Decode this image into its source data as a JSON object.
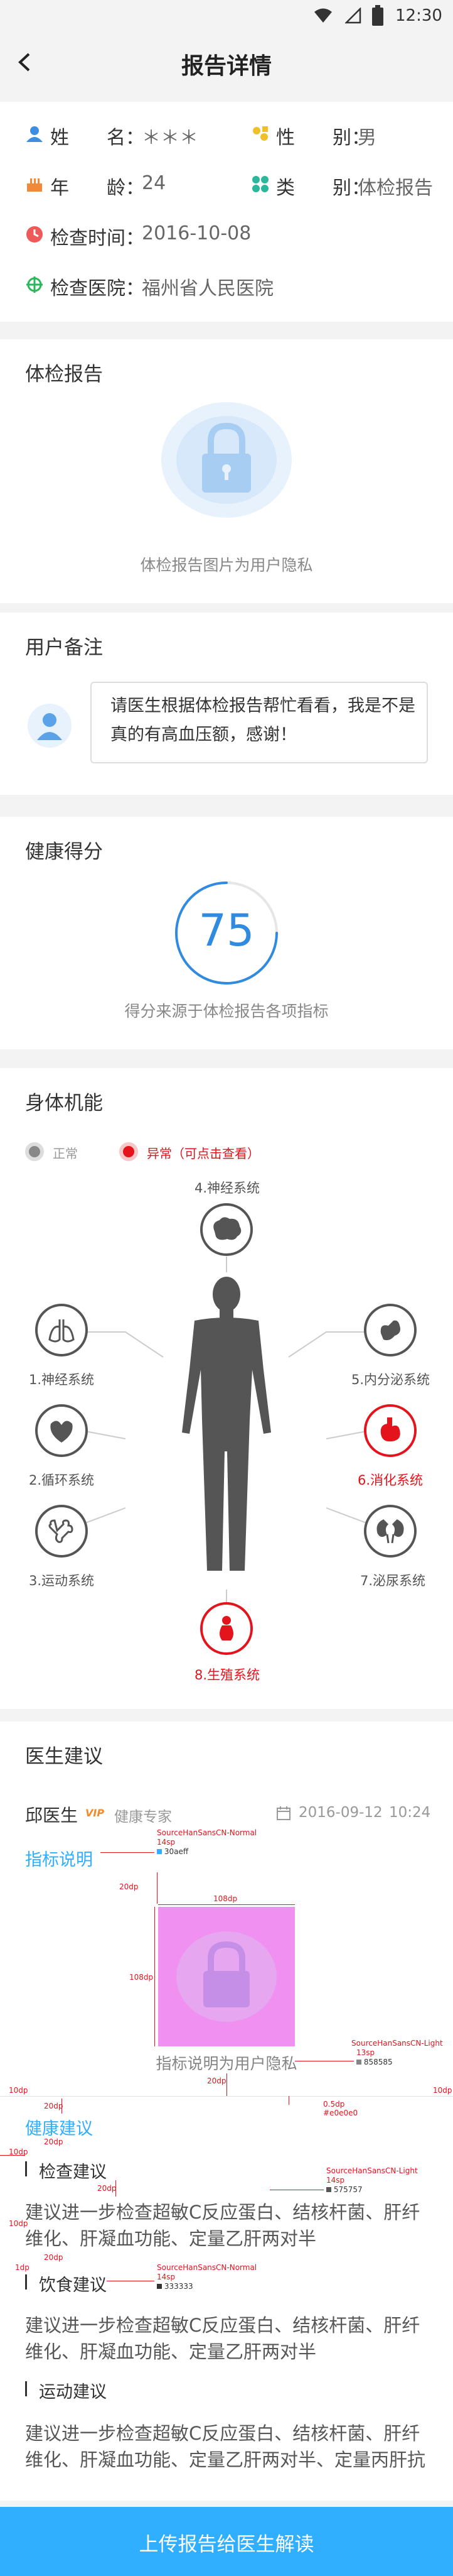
{
  "status_bar": {
    "time": "12:30"
  },
  "header": {
    "title": "报告详情"
  },
  "info": {
    "name_label": "姓　　名：",
    "name_value": "＊＊＊",
    "gender_label": "性　　别：",
    "gender_value": "男",
    "age_label": "年　　龄：",
    "age_value": "24",
    "type_label": "类　　别：",
    "type_value": "体检报告",
    "date_label": "检查时间：",
    "date_value": "2016-10-08",
    "hospital_label": "检查医院：",
    "hospital_value": "福州省人民医院"
  },
  "report": {
    "title": "体检报告",
    "privacy_text": "体检报告图片为用户隐私"
  },
  "remark": {
    "title": "用户备注",
    "text": "请医生根据体检报告帮忙看看，我是不是真的有高血压额，感谢！"
  },
  "score": {
    "title": "健康得分",
    "value": "75",
    "note": "得分来源于体检报告各项指标",
    "fraction": 0.75,
    "color": "#2f8ae0"
  },
  "body_function": {
    "title": "身体机能",
    "legend_normal": "正常",
    "legend_abnormal": "异常（可点击查看）",
    "systems": [
      {
        "label": "1.神经系统",
        "abnormal": false,
        "icon": "lungs-icon"
      },
      {
        "label": "2.循环系统",
        "abnormal": false,
        "icon": "heart-icon"
      },
      {
        "label": "3.运动系统",
        "abnormal": false,
        "icon": "bone-icon"
      },
      {
        "label": "4.神经系统",
        "abnormal": false,
        "icon": "brain-icon"
      },
      {
        "label": "5.内分泌系统",
        "abnormal": false,
        "icon": "endocrine-icon"
      },
      {
        "label": "6.消化系统",
        "abnormal": true,
        "icon": "stomach-icon"
      },
      {
        "label": "7.泌尿系统",
        "abnormal": false,
        "icon": "kidney-icon"
      },
      {
        "label": "8.生殖系统",
        "abnormal": true,
        "icon": "reproductive-icon"
      }
    ],
    "colors": {
      "normal": "#555555",
      "abnormal": "#e4141d"
    }
  },
  "advice": {
    "title": "医生建议",
    "doctor_name": "邱医生",
    "vip_badge": "VIP",
    "doctor_role": "健康专家",
    "date": "2016-09-12",
    "time": "10:24",
    "indicator_title": "指标说明",
    "indicator_privacy": "指标说明为用户隐私",
    "health_title": "健康建议",
    "exam_title": "检查建议",
    "exam_text": "建议进一步检查超敏C反应蛋白、结核杆菌、肝纤维化、肝凝血功能、定量乙肝两对半",
    "diet_title": "饮食建议",
    "diet_text": "建议进一步检查超敏C反应蛋白、结核杆菌、肝纤维化、肝凝血功能、定量乙肝两对半",
    "sport_title": "运动建议",
    "sport_text": "建议进一步检查超敏C反应蛋白、结核杆菌、肝纤维化、肝凝血功能、定量乙肝两对半、定量丙肝抗"
  },
  "annotations": {
    "a1": "SourceHanSansCN-Normal",
    "a1b": "14sp",
    "a1c": "30aeff",
    "a2": "SourceHanSansCN-Light",
    "a2b": "13sp",
    "a2c": "858585",
    "a3": "0.5dp",
    "a3b": "#e0e0e0",
    "a4": "SourceHanSansCN-Light",
    "a4b": "14sp",
    "a4c": "575757",
    "a5": "SourceHanSansCN-Normal",
    "a5b": "14sp",
    "a5c": "333333",
    "d20": "20dp",
    "d108": "108dp",
    "d10": "10dp",
    "d1": "1dp"
  },
  "upload_button": {
    "label": "上传报告给医生解读"
  }
}
